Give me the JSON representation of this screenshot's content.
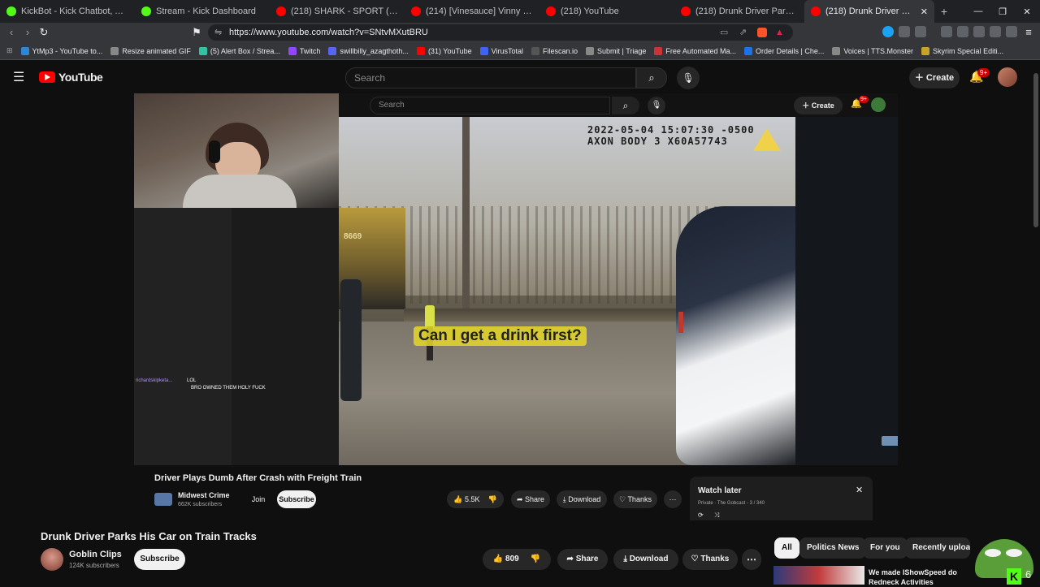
{
  "browser": {
    "tabs": [
      {
        "title": "KickBot - Kick Chatbot, Alerts, TTS, O",
        "favicon_color": "#53fc18"
      },
      {
        "title": "Stream - Kick Dashboard",
        "favicon_color": "#53fc18"
      },
      {
        "title": "(218) SHARK - SPORT (Official Video)",
        "favicon_color": "#ff0000"
      },
      {
        "title": "(214) [Vinesauce] Vinny - Shitty Luigi",
        "favicon_color": "#ff0000"
      },
      {
        "title": "(218) YouTube",
        "favicon_color": "#ff0000"
      },
      {
        "title": "(218) Drunk Driver Parks His C",
        "favicon_color": "#ff0000"
      }
    ],
    "new_tab": "+",
    "url": "https://www.youtube.com/watch?v=SNtvMXutBRU",
    "bookmarks": [
      {
        "label": "YtMp3 - YouTube to...",
        "color": "#2b88d8"
      },
      {
        "label": "Resize animated GIF",
        "color": "#888888"
      },
      {
        "label": "(5) Alert Box / Strea...",
        "color": "#31c3a2"
      },
      {
        "label": "Twitch",
        "color": "#9146ff"
      },
      {
        "label": "swillbilly_azagthoth...",
        "color": "#5865f2"
      },
      {
        "label": "(31) YouTube",
        "color": "#ff0000"
      },
      {
        "label": "VirusTotal",
        "color": "#3d64f5"
      },
      {
        "label": "Filescan.io",
        "color": "#555555"
      },
      {
        "label": "Submit | Triage",
        "color": "#888888"
      },
      {
        "label": "Free Automated Ma...",
        "color": "#cc3333"
      },
      {
        "label": "Order Details | Che...",
        "color": "#1a73e8"
      },
      {
        "label": "Voices | TTS.Monster",
        "color": "#888888"
      },
      {
        "label": "Skyrim Special Editi...",
        "color": "#c9a227"
      }
    ]
  },
  "youtube": {
    "logo_text": "YouTube",
    "search_placeholder": "Search",
    "create_label": "Create",
    "notif_badge": "9+",
    "accent": "#ff0000"
  },
  "stream_overlay": {
    "inner_search": "Search",
    "inner_create": "Create",
    "inner_badge": "9+",
    "bodycam_stamp_line1": "2022-05-04 15:07:30 -0500",
    "bodycam_stamp_line2": "AXON BODY 3 X60A57743",
    "caption": "Can I get a drink first?",
    "chat_user": "richardskipketa...",
    "chat_msg1": "LOL",
    "chat_msg2": "BRO OWNED THEM HOLY FUCK",
    "train_number": "8669",
    "inner_video_title": "Driver Plays Dumb After Crash with Freight Train",
    "inner_channel": "Midwest Crime",
    "inner_subs": "662K subscribers",
    "inner_join": "Join",
    "inner_subscribe": "Subscribe",
    "inner_likes": "5.5K",
    "inner_share": "Share",
    "inner_download": "Download",
    "inner_thanks": "Thanks",
    "watch_later_title": "Watch later",
    "watch_later_sub": "Private · The Gobcast - 3 / 340"
  },
  "video": {
    "title": "Drunk Driver Parks His Car on Train Tracks",
    "channel": "Goblin Clips",
    "subscribers": "124K subscribers",
    "subscribe_label": "Subscribe",
    "likes": "809",
    "share_label": "Share",
    "download_label": "Download",
    "thanks_label": "Thanks"
  },
  "chips": [
    "All",
    "Politics News",
    "For you",
    "Recently uploa"
  ],
  "recommendation": {
    "title_line1": "We made IShowSpeed do",
    "title_line2": "Redneck Activities"
  },
  "emote_badge": "6"
}
